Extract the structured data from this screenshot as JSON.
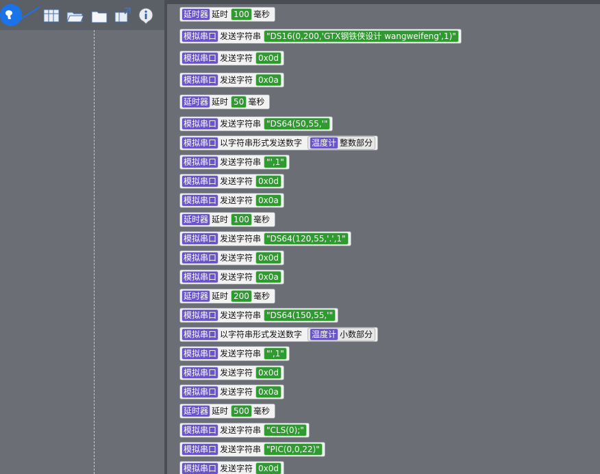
{
  "toolbar": {
    "buttons": [
      "logo-icon",
      "new-file-icon",
      "open-folder-icon",
      "folder-icon",
      "export-icon",
      "info-icon"
    ]
  },
  "blocks": {
    "delay_tag": "延时器",
    "delay_label": "延时",
    "delay_unit": "毫秒",
    "serial_tag": "模拟串口",
    "send_string": "发送字符串",
    "send_char": "发送字符",
    "send_number_as_string": "以字符串形式发送数字",
    "thermo_tag": "温度计",
    "integer_part": "整数部分",
    "fraction_part": "小数部分"
  },
  "rows": [
    {
      "type": "delay",
      "value": "100"
    },
    {
      "type": "str",
      "value": "\"DS16(0,200,'GTX钢铁侠设计 wangweifeng',1)\""
    },
    {
      "type": "char",
      "value": "0x0d"
    },
    {
      "type": "char",
      "value": "0x0a"
    },
    {
      "type": "delay",
      "value": "50"
    },
    {
      "type": "str",
      "value": "\"DS64(50,55,'\""
    },
    {
      "type": "num",
      "part": "integer"
    },
    {
      "type": "str",
      "value": "\"',1\""
    },
    {
      "type": "char",
      "value": "0x0d"
    },
    {
      "type": "char",
      "value": "0x0a"
    },
    {
      "type": "delay",
      "value": "100"
    },
    {
      "type": "str",
      "value": "\"DS64(120,55,'.',1\""
    },
    {
      "type": "char",
      "value": "0x0d"
    },
    {
      "type": "char",
      "value": "0x0a"
    },
    {
      "type": "delay",
      "value": "200"
    },
    {
      "type": "str",
      "value": "\"DS64(150,55,'\""
    },
    {
      "type": "num",
      "part": "fraction"
    },
    {
      "type": "str",
      "value": "\"',1\""
    },
    {
      "type": "char",
      "value": "0x0d"
    },
    {
      "type": "char",
      "value": "0x0a"
    },
    {
      "type": "delay",
      "value": "500"
    },
    {
      "type": "str",
      "value": "\"CLS(0);\""
    },
    {
      "type": "str",
      "value": "\"PIC(0,0,22)\""
    },
    {
      "type": "char",
      "value": "0x0d"
    }
  ]
}
